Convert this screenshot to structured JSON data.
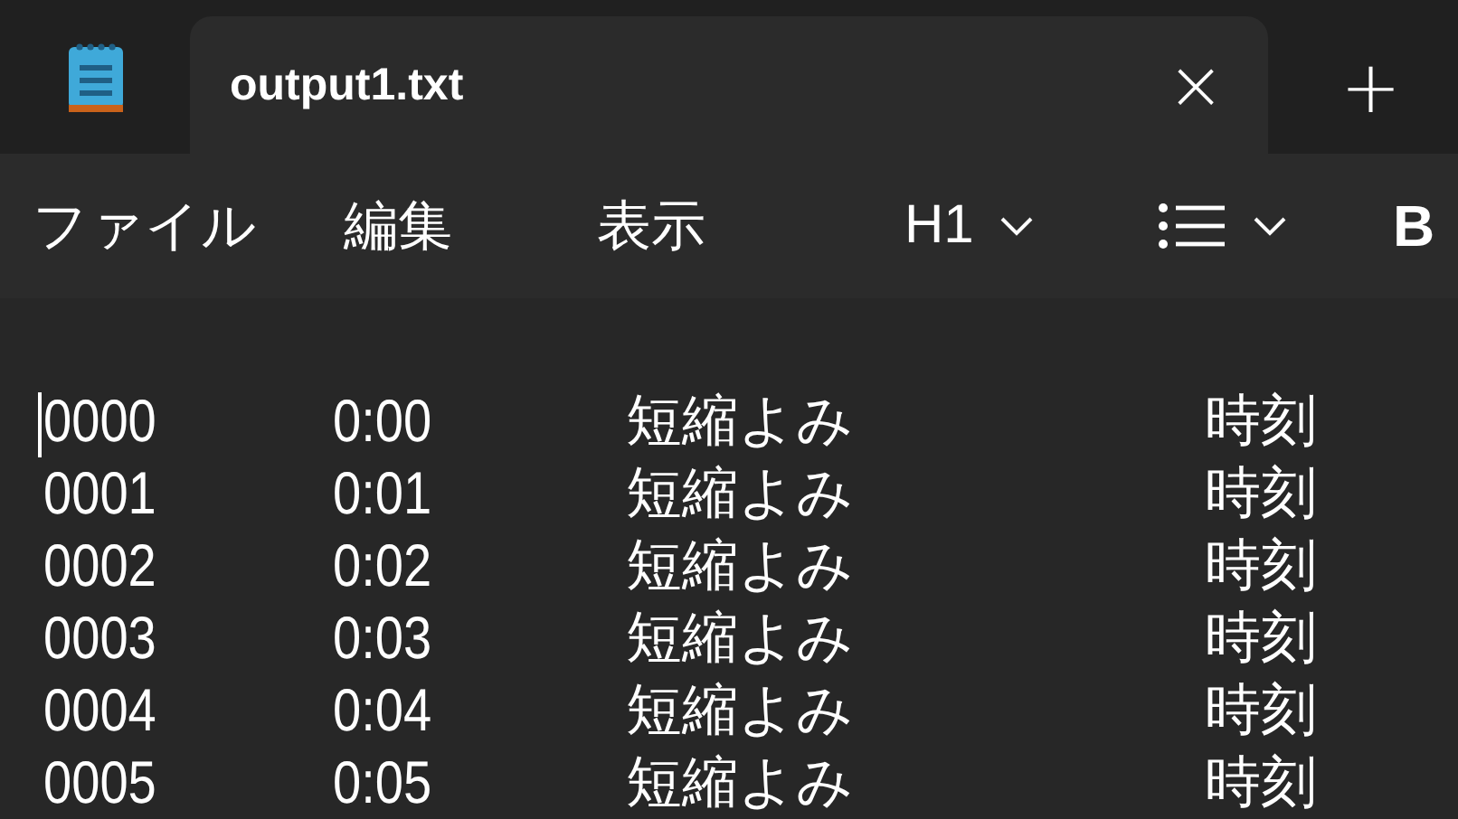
{
  "tab": {
    "title": "output1.txt",
    "close": "×",
    "new_tab": "+"
  },
  "menu": [
    {
      "kind": "menu",
      "label": "ファイル"
    },
    {
      "kind": "menu",
      "label": "編集"
    },
    {
      "kind": "menu",
      "label": "表示"
    },
    {
      "kind": "dropdown",
      "label": "H1"
    },
    {
      "kind": "list"
    },
    {
      "kind": "bold",
      "label": "B"
    }
  ],
  "rows": [
    [
      "0000",
      "0:00",
      "短縮よみ",
      "時刻"
    ],
    [
      "0001",
      "0:01",
      "短縮よみ",
      "時刻"
    ],
    [
      "0002",
      "0:02",
      "短縮よみ",
      "時刻"
    ],
    [
      "0003",
      "0:03",
      "短縮よみ",
      "時刻"
    ],
    [
      "0004",
      "0:04",
      "短縮よみ",
      "時刻"
    ],
    [
      "0005",
      "0:05",
      "短縮よみ",
      "時刻"
    ]
  ]
}
